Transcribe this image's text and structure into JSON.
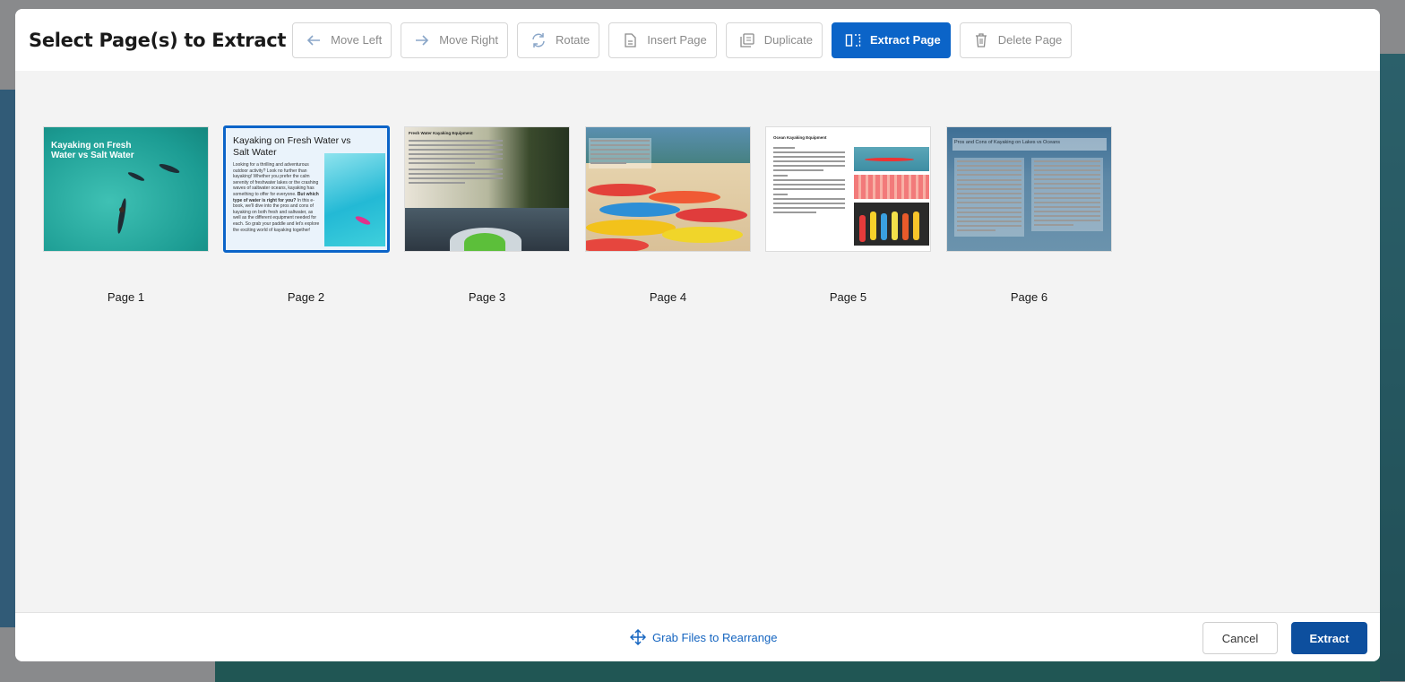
{
  "dialog": {
    "title": "Select Page(s) to Extract"
  },
  "toolbar": {
    "move_left": "Move Left",
    "move_right": "Move Right",
    "rotate": "Rotate",
    "insert_page": "Insert Page",
    "duplicate": "Duplicate",
    "extract_page": "Extract Page",
    "delete_page": "Delete Page"
  },
  "pages": [
    {
      "label": "Page 1",
      "heading": "Kayaking on Fresh Water vs Salt Water",
      "selected": false
    },
    {
      "label": "Page 2",
      "heading": "Kayaking on Fresh Water vs Salt Water",
      "selected": true,
      "body": "Looking for a thrilling and adventurous outdoor activity? Look no further than kayaking! Whether you prefer the calm serenity of freshwater lakes or the crashing waves of saltwater oceans, kayaking has something to offer for everyone.",
      "body_bold": "But which type of water is right for you?",
      "body_rest": "In this e-book, we'll dive into the pros and cons of kayaking on both fresh and saltwater, as well as the different equipment needed for each. So grab your paddle and let's explore the exciting world of kayaking together!"
    },
    {
      "label": "Page 3",
      "heading": "Fresh Water Kayaking Equipment",
      "selected": false
    },
    {
      "label": "Page 4",
      "selected": false
    },
    {
      "label": "Page 5",
      "heading": "Ocean Kayaking Equipment",
      "selected": false
    },
    {
      "label": "Page 6",
      "heading": "Pros and Cons of Kayaking on Lakes vs Oceans",
      "selected": false
    }
  ],
  "footer": {
    "grab_label": "Grab Files to Rearrange",
    "cancel": "Cancel",
    "extract": "Extract"
  },
  "colors": {
    "primary": "#0b64c8",
    "extract_button": "#0d4f9e",
    "link": "#1565c0"
  }
}
